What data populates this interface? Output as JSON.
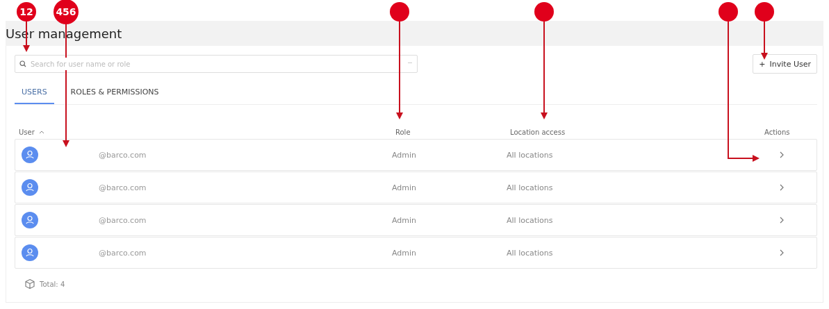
{
  "title": "User management",
  "search": {
    "placeholder": "Search for user name or role"
  },
  "invite_button": {
    "label": "Invite User",
    "icon": "+"
  },
  "tabs": [
    {
      "label": "USERS",
      "selected": true
    },
    {
      "label": "ROLES & PERMISSIONS",
      "selected": false
    }
  ],
  "table": {
    "columns": [
      {
        "label": "User",
        "sorted": true
      },
      {
        "label": "Role",
        "sorted": false
      },
      {
        "label": "Location access",
        "sorted": false
      },
      {
        "label": "Actions",
        "sorted": false
      }
    ],
    "rows": [
      {
        "user": "@barco.com",
        "role": "Admin",
        "location": "All locations"
      },
      {
        "user": "@barco.com",
        "role": "Admin",
        "location": "All locations"
      },
      {
        "user": "@barco.com",
        "role": "Admin",
        "location": "All locations"
      },
      {
        "user": "@barco.com",
        "role": "Admin",
        "location": "All locations"
      }
    ]
  },
  "total": "Total: 4",
  "callouts": [
    {
      "label": "12",
      "kind": "down"
    },
    {
      "label": "456",
      "kind": "down"
    },
    {
      "kind": "down"
    },
    {
      "kind": "down"
    },
    {
      "kind": "elbow"
    },
    {
      "kind": "down"
    }
  ]
}
